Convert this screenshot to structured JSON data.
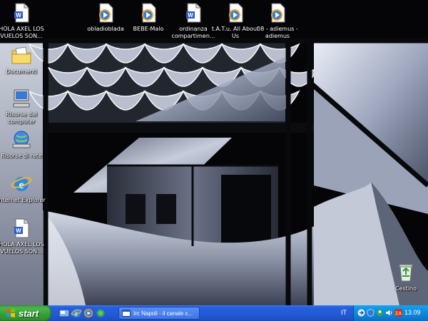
{
  "desktop": {
    "icons_top": [
      {
        "label": "HOLA AXEL LOS VUELOS SON...",
        "icon": "word-document-icon"
      },
      {
        "label": "obladioblada",
        "icon": "media-file-icon"
      },
      {
        "label": "BEBE-Malo",
        "icon": "media-file-icon"
      },
      {
        "label": "ordinanza compartimen...",
        "icon": "word-document-icon"
      },
      {
        "label": "t.A.T.u. All About Us",
        "icon": "media-file-icon"
      },
      {
        "label": "08 - adiemus - adiemus",
        "icon": "media-file-icon"
      }
    ],
    "icons_left": [
      {
        "label": "Documenti",
        "icon": "my-documents-folder-icon"
      },
      {
        "label": "Risorse del computer",
        "icon": "my-computer-icon"
      },
      {
        "label": "Risorse di rete",
        "icon": "network-places-icon"
      },
      {
        "label": "Internet Explorer",
        "icon": "internet-explorer-icon"
      },
      {
        "label": "HOLA AXEL LOS VUELOS SON...",
        "icon": "word-document-icon"
      }
    ],
    "recycle_bin": {
      "label": "Cestino",
      "icon": "recycle-bin-icon"
    }
  },
  "taskbar": {
    "start_label": "start",
    "quick_launch": [
      "show-desktop-icon",
      "internet-explorer-icon",
      "media-player-icon",
      "messenger-icon"
    ],
    "tasks": [
      {
        "label": "Irc Napoli - il canale c...",
        "icon": "irc-client-icon"
      }
    ],
    "language": "IT",
    "tray_icons": [
      "network-icon",
      "security-icon",
      "messenger-icon",
      "volume-icon",
      "antivirus-icon"
    ],
    "clock": "13.09"
  }
}
